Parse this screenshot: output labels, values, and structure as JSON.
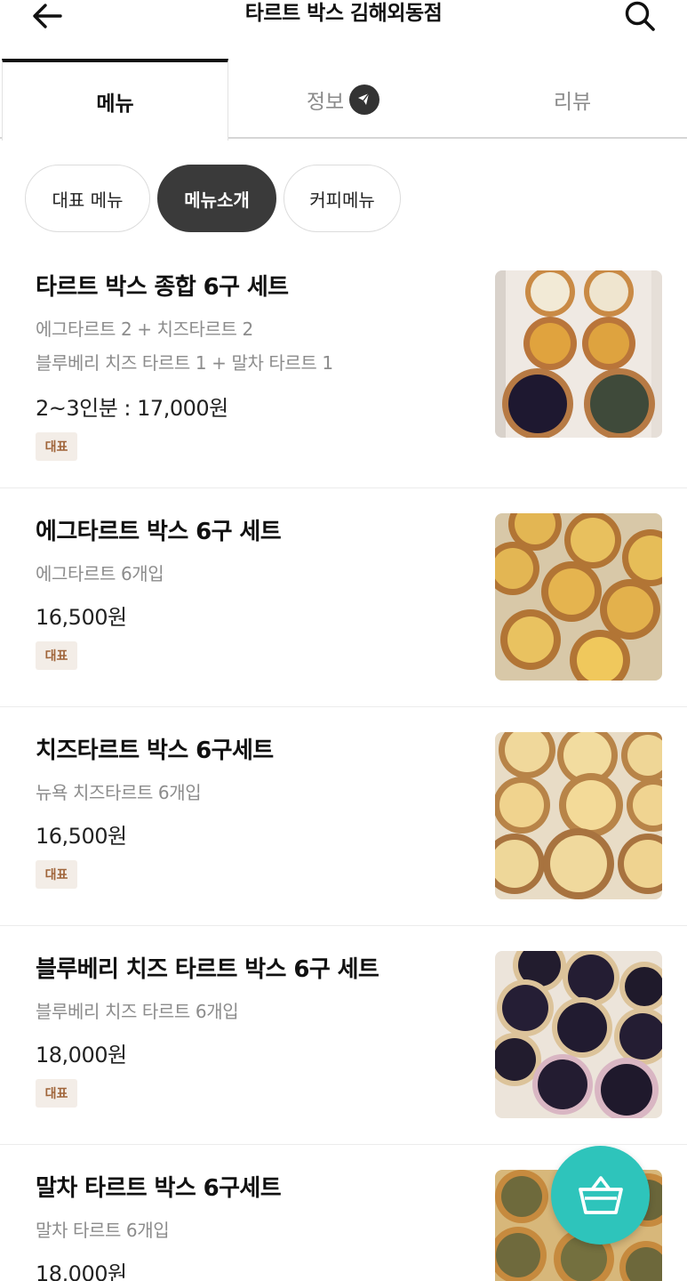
{
  "header": {
    "title": "타르트 박스 김해외동점",
    "back_icon": "arrow-left-icon",
    "search_icon": "search-icon"
  },
  "tabs": [
    {
      "label": "메뉴",
      "active": true
    },
    {
      "label": "정보",
      "icon": "megaphone-icon"
    },
    {
      "label": "리뷰"
    }
  ],
  "chips": [
    {
      "label": "대표 메뉴"
    },
    {
      "label": "메뉴소개",
      "selected": true
    },
    {
      "label": "커피메뉴"
    }
  ],
  "items": [
    {
      "name": "타르트 박스 종합 6구 세트",
      "desc": [
        "에그타르트 2 + 치즈타르트 2",
        "블루베리 치즈 타르트 1 + 말차 타르트 1"
      ],
      "price": "2~3인분 : 17,000원",
      "badge": "대표"
    },
    {
      "name": "에그타르트 박스 6구 세트",
      "desc": [
        "에그타르트 6개입"
      ],
      "price": "16,500원",
      "badge": "대표"
    },
    {
      "name": "치즈타르트 박스 6구세트",
      "desc": [
        "뉴욕 치즈타르트 6개입"
      ],
      "price": "16,500원",
      "badge": "대표"
    },
    {
      "name": "블루베리 치즈 타르트 박스  6구 세트",
      "desc": [
        "블루베리 치즈 타르트  6개입"
      ],
      "price": "18,000원",
      "badge": "대표"
    },
    {
      "name": "말차 타르트 박스  6구세트",
      "desc": [
        "말차 타르트 6개입"
      ],
      "price": "18,000원"
    }
  ],
  "cart": {
    "icon": "shopping-basket-icon"
  },
  "colors": {
    "accent": "#2ec4bb",
    "chip_selected": "#3a3a3a",
    "badge_text": "#a0653a",
    "badge_bg": "#f3ede7"
  }
}
